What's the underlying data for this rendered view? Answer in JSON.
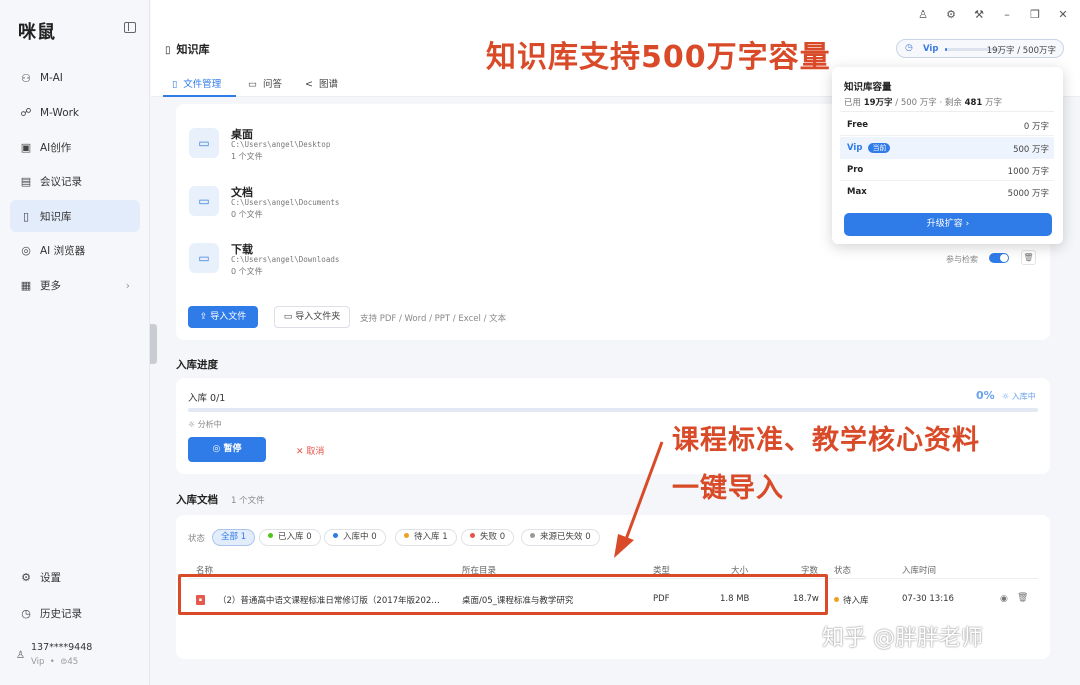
{
  "app": {
    "logo": "咪鼠"
  },
  "sidebar": {
    "items": [
      {
        "icon": "ai-chip-icon",
        "glyph": "⚇",
        "label": "M-AI"
      },
      {
        "icon": "work-icon",
        "glyph": "☍",
        "label": "M-Work"
      },
      {
        "icon": "image-create-icon",
        "glyph": "▣",
        "label": "AI创作"
      },
      {
        "icon": "meeting-record-icon",
        "glyph": "▤",
        "label": "会议记录"
      },
      {
        "icon": "book-icon",
        "glyph": "▯",
        "label": "知识库"
      },
      {
        "icon": "compass-icon",
        "glyph": "◎",
        "label": "AI 浏览器"
      },
      {
        "icon": "grid-icon",
        "glyph": "▦",
        "label": "更多"
      }
    ],
    "more_arrow": "›",
    "bottom": [
      {
        "icon": "gear-icon",
        "glyph": "⚙",
        "label": "设置"
      },
      {
        "icon": "history-icon",
        "glyph": "◷",
        "label": "历史记录"
      }
    ],
    "user": {
      "phone": "137****9448",
      "tier": "Vip",
      "sep": "•",
      "points": "⊜45"
    }
  },
  "header": {
    "title": "知识库",
    "vip_label": "Vip",
    "usage_text": "19万字 / 500万字",
    "usage_fraction": 0.038
  },
  "tabs": [
    {
      "label": "文件管理",
      "glyph": "▯"
    },
    {
      "label": "问答",
      "glyph": "▭"
    },
    {
      "label": "图谱",
      "glyph": "<"
    }
  ],
  "folders": [
    {
      "name": "桌面",
      "path": "C:\\Users\\angel\\Desktop",
      "count": "1 个文件"
    },
    {
      "name": "文档",
      "path": "C:\\Users\\angel\\Documents",
      "count": "0 个文件"
    },
    {
      "name": "下载",
      "path": "C:\\Users\\angel\\Downloads",
      "count": "0 个文件"
    }
  ],
  "import": {
    "import_files": "导入文件",
    "import_folder": "导入文件夹",
    "support_hint": "支持 PDF / Word / PPT / Excel / 文本"
  },
  "retrieval": {
    "label": "参与检索"
  },
  "progress": {
    "section_title": "入库进度",
    "label": "入库 0/1",
    "percent_text": "0%",
    "status": "入库中",
    "analyzing": "分析中",
    "pause": "暂停",
    "cancel": "取消",
    "value": 0.0
  },
  "docs": {
    "section_title": "入库文档",
    "count": "1 个文件",
    "filter_label": "状态",
    "filters": [
      {
        "label": "全部 1",
        "color": ""
      },
      {
        "label": "已入库 0",
        "color": "#52c41a"
      },
      {
        "label": "入库中 0",
        "color": "#2f7be8"
      },
      {
        "label": "待入库 1",
        "color": "#f0a020"
      },
      {
        "label": "失败 0",
        "color": "#e8524a"
      },
      {
        "label": "来源已失效 0",
        "color": "#999999"
      }
    ],
    "columns": [
      "名称",
      "所在目录",
      "类型",
      "大小",
      "字数",
      "状态",
      "入库时间"
    ],
    "rows": [
      {
        "name": "（2）普通高中语文课程标准日常修订版（2017年版202…",
        "dir": "桌面/05_课程标准与教学研究",
        "type": "PDF",
        "size": "1.8 MB",
        "words": "18.7w",
        "status": "待入库",
        "time": "07-30 13:16"
      }
    ]
  },
  "popup": {
    "title": "知识库容量",
    "used_prefix": "已用",
    "used": "19万字",
    "total_text": "/ 500 万字 · 剩余",
    "remain": "481",
    "remain_unit": "万字",
    "tiers": [
      {
        "name": "Free",
        "value": "0 万字",
        "current": false
      },
      {
        "name": "Vip",
        "value": "500 万字",
        "current": true,
        "badge": "当前"
      },
      {
        "name": "Pro",
        "value": "1000 万字",
        "current": false
      },
      {
        "name": "Max",
        "value": "5000 万字",
        "current": false
      }
    ],
    "upgrade": "升级扩容 ›"
  },
  "annotations": {
    "top": "知识库支持500万字容量",
    "mid_line1": "课程标准、教学核心资料",
    "mid_line2": "一键导入",
    "watermark": "知乎 @胖胖老师",
    "color": "#d94a28"
  }
}
